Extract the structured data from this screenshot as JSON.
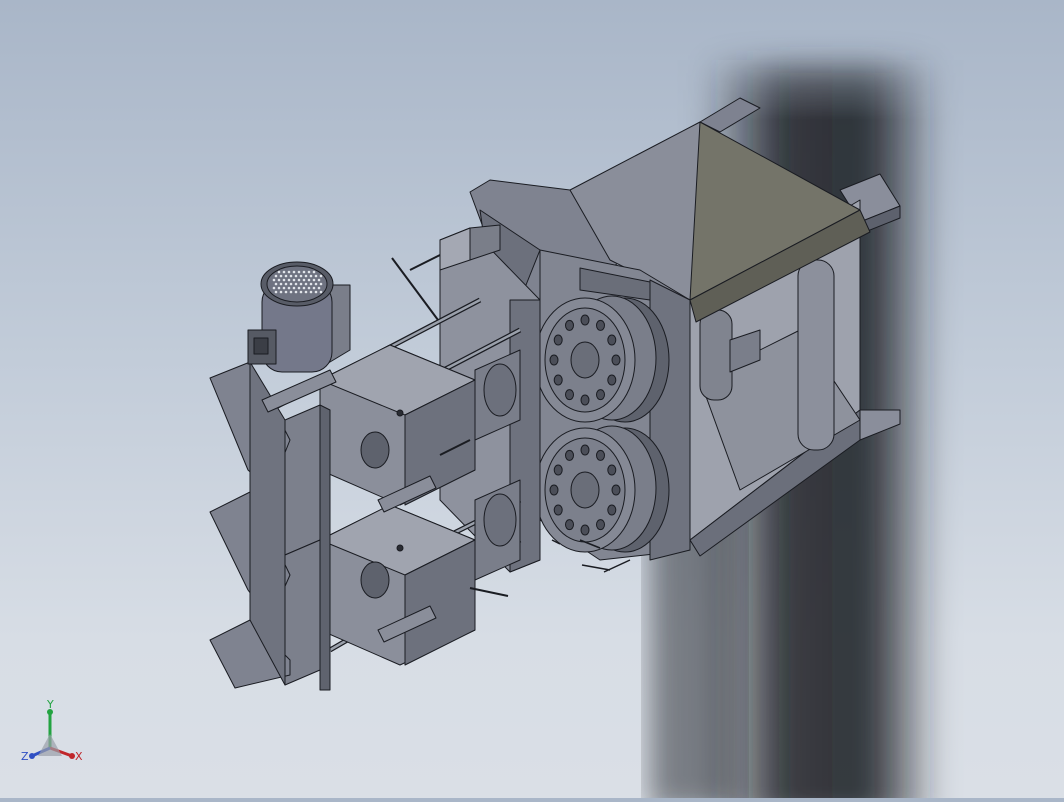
{
  "viewport": {
    "background_top": "#a9b6c8",
    "background_bottom": "#dadfe6",
    "model_steel": "#707483",
    "model_edge": "#1a1c22",
    "model_plate": "#727269"
  },
  "triad": {
    "x_label": "X",
    "y_label": "Y",
    "z_label": "Z",
    "x_color": "#c0262b",
    "y_color": "#22a341",
    "z_color": "#2f4fc4"
  }
}
